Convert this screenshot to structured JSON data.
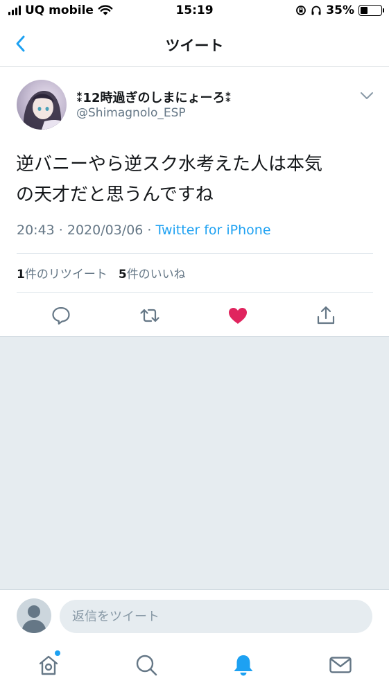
{
  "status_bar": {
    "carrier": "UQ mobile",
    "time": "15:19",
    "battery": "35%",
    "battery_level": 0.35
  },
  "nav": {
    "title": "ツイート"
  },
  "tweet": {
    "display_name": "⁑12時過ぎのしまにょーろ⁑",
    "handle": "@Shimagnolo_ESP",
    "text_line1": "逆バニーやら逆スク水考えた人は本気",
    "text_line2": "の天才だと思うんですね",
    "time": "20:43 · 2020/03/06 · ",
    "source": "Twitter for iPhone",
    "retweet_count": "1",
    "retweet_label": "件のリツイート",
    "like_count": "5",
    "like_label": "件のいいね"
  },
  "reply": {
    "placeholder": "返信をツイート"
  },
  "colors": {
    "accent": "#1da1f2",
    "like": "#e0245e",
    "muted": "#657786"
  },
  "icons": {
    "back": "chevron-left-icon",
    "more": "chevron-down-icon",
    "reply": "comment-icon",
    "retweet": "retweet-icon",
    "like": "heart-icon",
    "share": "share-icon",
    "home": "home-icon",
    "search": "search-icon",
    "notifications": "bell-icon",
    "messages": "mail-icon"
  }
}
